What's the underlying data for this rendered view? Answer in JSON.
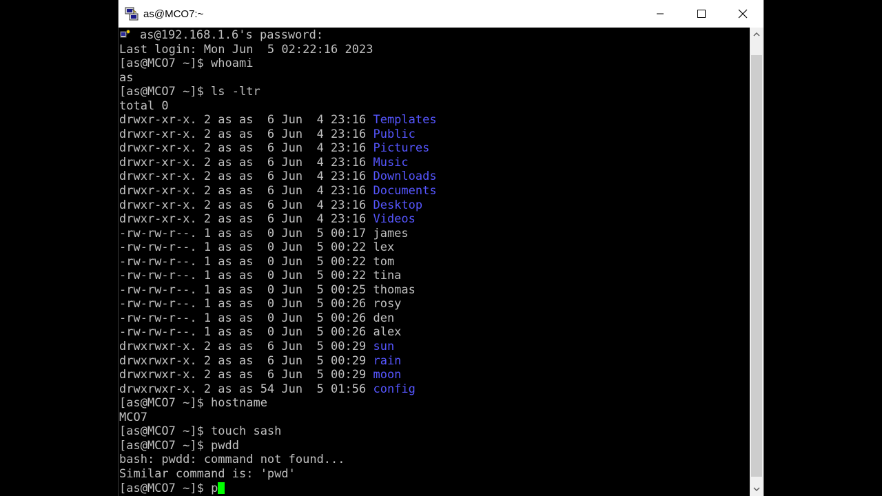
{
  "window": {
    "title": "as@MCO7:~"
  },
  "terminal": {
    "password_prompt": "as@192.168.1.6's password:",
    "lines": [
      {
        "pre": "Last login: Mon Jun  5 02:22:16 2023",
        "name": ""
      },
      {
        "pre": "[as@MCO7 ~]$ whoami",
        "name": ""
      },
      {
        "pre": "as",
        "name": ""
      },
      {
        "pre": "[as@MCO7 ~]$ ls -ltr",
        "name": ""
      },
      {
        "pre": "total 0",
        "name": ""
      },
      {
        "pre": "drwxr-xr-x. 2 as as  6 Jun  4 23:16 ",
        "name": "Templates",
        "dir": true
      },
      {
        "pre": "drwxr-xr-x. 2 as as  6 Jun  4 23:16 ",
        "name": "Public",
        "dir": true
      },
      {
        "pre": "drwxr-xr-x. 2 as as  6 Jun  4 23:16 ",
        "name": "Pictures",
        "dir": true
      },
      {
        "pre": "drwxr-xr-x. 2 as as  6 Jun  4 23:16 ",
        "name": "Music",
        "dir": true
      },
      {
        "pre": "drwxr-xr-x. 2 as as  6 Jun  4 23:16 ",
        "name": "Downloads",
        "dir": true
      },
      {
        "pre": "drwxr-xr-x. 2 as as  6 Jun  4 23:16 ",
        "name": "Documents",
        "dir": true
      },
      {
        "pre": "drwxr-xr-x. 2 as as  6 Jun  4 23:16 ",
        "name": "Desktop",
        "dir": true
      },
      {
        "pre": "drwxr-xr-x. 2 as as  6 Jun  4 23:16 ",
        "name": "Videos",
        "dir": true
      },
      {
        "pre": "-rw-rw-r--. 1 as as  0 Jun  5 00:17 ",
        "name": "james"
      },
      {
        "pre": "-rw-rw-r--. 1 as as  0 Jun  5 00:22 ",
        "name": "lex"
      },
      {
        "pre": "-rw-rw-r--. 1 as as  0 Jun  5 00:22 ",
        "name": "tom"
      },
      {
        "pre": "-rw-rw-r--. 1 as as  0 Jun  5 00:22 ",
        "name": "tina"
      },
      {
        "pre": "-rw-rw-r--. 1 as as  0 Jun  5 00:25 ",
        "name": "thomas"
      },
      {
        "pre": "-rw-rw-r--. 1 as as  0 Jun  5 00:26 ",
        "name": "rosy"
      },
      {
        "pre": "-rw-rw-r--. 1 as as  0 Jun  5 00:26 ",
        "name": "den"
      },
      {
        "pre": "-rw-rw-r--. 1 as as  0 Jun  5 00:26 ",
        "name": "alex"
      },
      {
        "pre": "drwxrwxr-x. 2 as as  6 Jun  5 00:29 ",
        "name": "sun",
        "dir": true
      },
      {
        "pre": "drwxrwxr-x. 2 as as  6 Jun  5 00:29 ",
        "name": "rain",
        "dir": true
      },
      {
        "pre": "drwxrwxr-x. 2 as as  6 Jun  5 00:29 ",
        "name": "moon",
        "dir": true
      },
      {
        "pre": "drwxrwxr-x. 2 as as 54 Jun  5 01:56 ",
        "name": "config",
        "dir": true
      },
      {
        "pre": "[as@MCO7 ~]$ hostname",
        "name": ""
      },
      {
        "pre": "MCO7",
        "name": ""
      },
      {
        "pre": "[as@MCO7 ~]$ touch sash",
        "name": ""
      },
      {
        "pre": "[as@MCO7 ~]$ pwdd",
        "name": ""
      },
      {
        "pre": "bash: pwdd: command not found...",
        "name": ""
      },
      {
        "pre": "Similar command is: 'pwd'",
        "name": ""
      }
    ],
    "current_prompt": "[as@MCO7 ~]$ ",
    "current_input": "p"
  },
  "colors": {
    "text": "#c0c0c0",
    "directory": "#5656ff",
    "cursor": "#00ff00",
    "background": "#000000"
  },
  "icons": {
    "app": "putty-icon",
    "minimize": "minimize-icon",
    "maximize": "maximize-icon",
    "close": "close-icon",
    "key": "key-icon",
    "scroll_up": "chevron-up-icon",
    "scroll_down": "chevron-down-icon"
  }
}
